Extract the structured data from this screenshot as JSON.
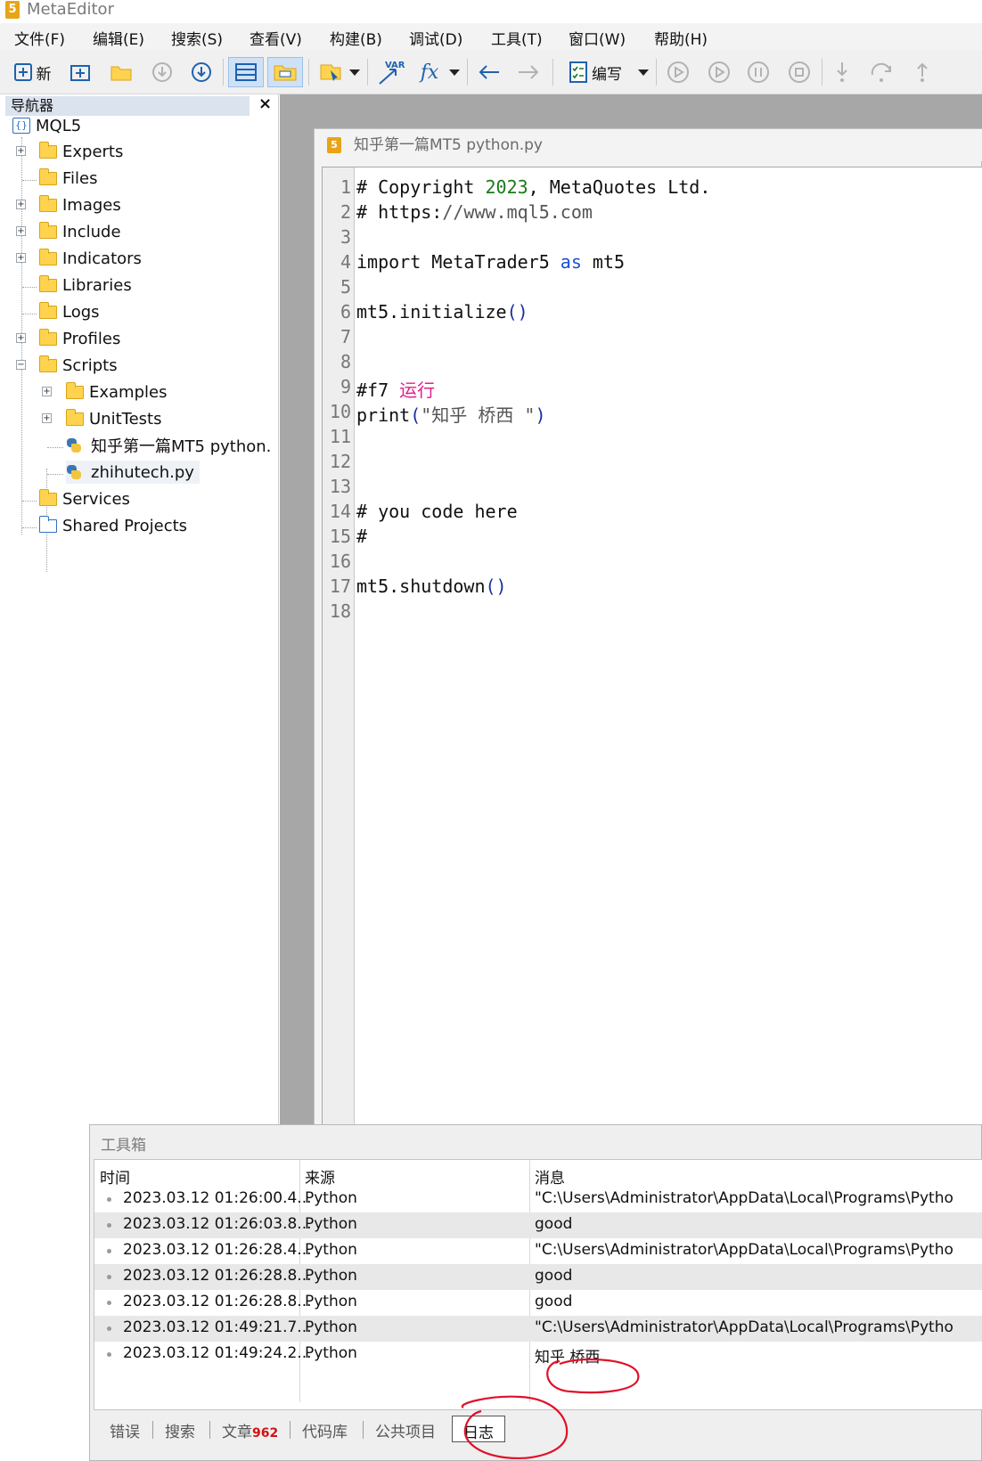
{
  "app": {
    "title": "MetaEditor",
    "logo_glyph": "5"
  },
  "menu": [
    "文件(F)",
    "编辑(E)",
    "搜索(S)",
    "查看(V)",
    "构建(B)",
    "调试(D)",
    "工具(T)",
    "窗口(W)",
    "帮助(H)"
  ],
  "toolbar": {
    "new_label": "新",
    "compile_label": "编写",
    "var_label": "VAR",
    "fx_label": "fx"
  },
  "navigator": {
    "title": "导航器",
    "close_glyph": "×",
    "root": "MQL5",
    "items": [
      "Experts",
      "Files",
      "Images",
      "Include",
      "Indicators",
      "Libraries",
      "Logs",
      "Profiles",
      "Scripts",
      "Examples",
      "UnitTests",
      "知乎第一篇MT5 python.",
      "zhihutech.py",
      "Services",
      "Shared Projects"
    ]
  },
  "editor": {
    "title": "知乎第一篇MT5 python.py",
    "line_numbers": [
      "1",
      "2",
      "3",
      "4",
      "5",
      "6",
      "7",
      "8",
      "9",
      "10",
      "11",
      "12",
      "13",
      "14",
      "15",
      "16",
      "17",
      "18"
    ],
    "code": {
      "l1_a": "# Copyright ",
      "l1_b": "2023",
      "l1_c": ", MetaQuotes Ltd.",
      "l2_a": "# https:",
      "l2_b": "//www.mql5.com",
      "l4_a": "import MetaTrader5 ",
      "l4_b": "as",
      "l4_c": " mt5",
      "l6_a": "mt5.initialize",
      "l6_b": "()",
      "l9_a": "#f7 ",
      "l9_b": "运行",
      "l10_a": "print",
      "l10_b": "(",
      "l10_c": "\"知乎 桥西 \"",
      "l10_d": ")",
      "l14": "# you code here",
      "l15": "#",
      "l17_a": "mt5.shutdown",
      "l17_b": "()"
    }
  },
  "toolbox": {
    "title": "工具箱",
    "columns": [
      "时间",
      "来源",
      "消息"
    ],
    "rows": [
      {
        "time": "2023.03.12 01:26:00.4...",
        "source": "Python",
        "message": "\"C:\\Users\\Administrator\\AppData\\Local\\Programs\\Pytho"
      },
      {
        "time": "2023.03.12 01:26:03.8...",
        "source": "Python",
        "message": "good"
      },
      {
        "time": "2023.03.12 01:26:28.4...",
        "source": "Python",
        "message": "\"C:\\Users\\Administrator\\AppData\\Local\\Programs\\Pytho"
      },
      {
        "time": "2023.03.12 01:26:28.8...",
        "source": "Python",
        "message": "good"
      },
      {
        "time": "2023.03.12 01:26:28.8...",
        "source": "Python",
        "message": "good"
      },
      {
        "time": "2023.03.12 01:49:21.7...",
        "source": "Python",
        "message": "\"C:\\Users\\Administrator\\AppData\\Local\\Programs\\Pytho"
      },
      {
        "time": "2023.03.12 01:49:24.2...",
        "source": "Python",
        "message": "知乎 桥西"
      }
    ],
    "tabs": [
      "错误",
      "搜索",
      "文章",
      "代码库",
      "公共项目",
      "日志"
    ],
    "articles_badge": "962",
    "active_tab": "日志"
  },
  "colors": {
    "accent": "#1e62b0",
    "annotation_ink": "#e0102a",
    "logo": "#e8a417"
  }
}
